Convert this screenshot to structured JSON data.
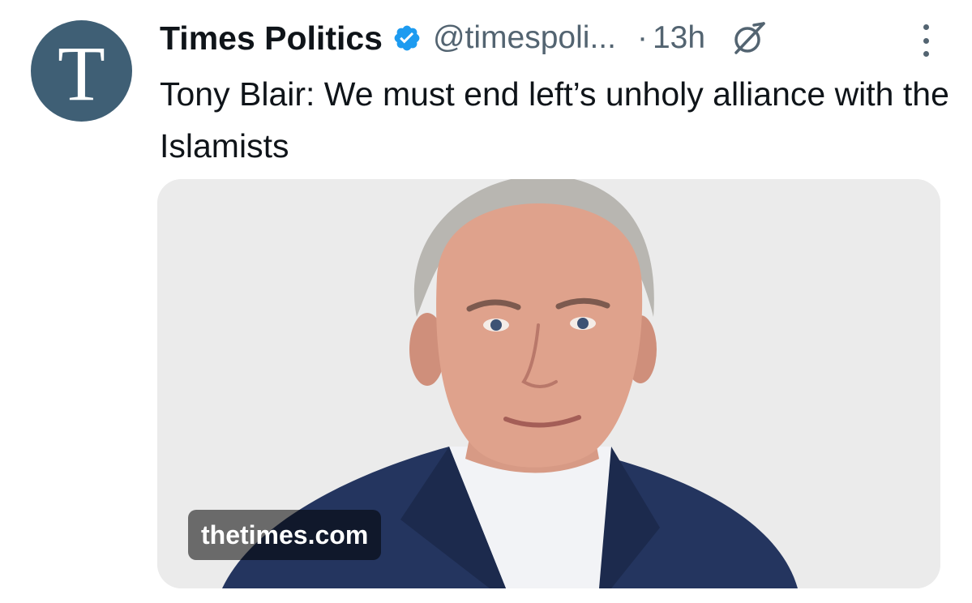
{
  "author": {
    "avatar_letter": "T",
    "name": "Times Politics",
    "handle": "@timespoli...",
    "separator": "·",
    "time": "13h",
    "verified_color": "#1d9bf0"
  },
  "post": {
    "text": "Tony Blair: We must end left’s unholy alliance with the Islamists"
  },
  "card": {
    "domain": "thetimes.com",
    "image": "portrait-photo"
  },
  "icons": {
    "verified": "verified-badge-icon",
    "grok": "grok-icon",
    "more": "more-options-icon"
  },
  "colors": {
    "text_primary": "#0f1419",
    "text_secondary": "#536471",
    "avatar_bg": "#3f5f75"
  }
}
